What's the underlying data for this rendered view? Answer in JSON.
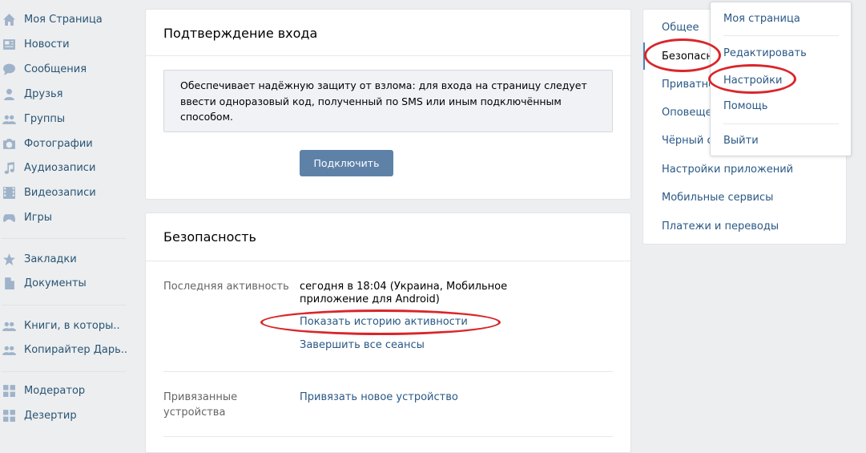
{
  "sidebar": {
    "items": [
      {
        "label": "Моя Страница",
        "icon": "home-icon"
      },
      {
        "label": "Новости",
        "icon": "news-icon"
      },
      {
        "label": "Сообщения",
        "icon": "messages-icon"
      },
      {
        "label": "Друзья",
        "icon": "friends-icon"
      },
      {
        "label": "Группы",
        "icon": "groups-icon"
      },
      {
        "label": "Фотографии",
        "icon": "camera-icon"
      },
      {
        "label": "Аудиозаписи",
        "icon": "music-note-icon"
      },
      {
        "label": "Видеозаписи",
        "icon": "film-icon"
      },
      {
        "label": "Игры",
        "icon": "gamepad-icon"
      },
      {
        "label": "Закладки",
        "icon": "star-icon"
      },
      {
        "label": "Документы",
        "icon": "document-icon"
      },
      {
        "label": "Книги, в которы..",
        "icon": "group-icon"
      },
      {
        "label": "Копирайтер Дарь..",
        "icon": "group-icon"
      },
      {
        "label": "Модератор",
        "icon": "apps-grid-icon"
      },
      {
        "label": "Дезертир",
        "icon": "apps-grid-icon"
      }
    ]
  },
  "login_confirm": {
    "title": "Подтверждение входа",
    "description": "Обеспечивает надёжную защиту от взлома: для входа на страницу следует ввести одноразовый код, полученный по SMS или иным подключённым способом.",
    "connect_button": "Подключить"
  },
  "security": {
    "title": "Безопасность",
    "last_activity_label": "Последняя активность",
    "last_activity_value": "сегодня в 18:04 (Украина, Мобильное приложение для Android)",
    "show_history_link": "Показать историю активности",
    "end_sessions_link": "Завершить все сеансы",
    "linked_devices_label": "Привязанные устройства",
    "link_device_link": "Привязать новое устройство"
  },
  "settings_menu": {
    "items": [
      {
        "label": "Общее"
      },
      {
        "label": "Безопасность"
      },
      {
        "label": "Приватность"
      },
      {
        "label": "Оповещения"
      },
      {
        "label": "Чёрный список"
      },
      {
        "label": "Настройки приложений"
      },
      {
        "label": "Мобильные сервисы"
      },
      {
        "label": "Платежи и переводы"
      }
    ]
  },
  "dropdown": {
    "items": [
      {
        "label": "Моя страница"
      },
      {
        "label": "Редактировать"
      },
      {
        "label": "Настройки"
      },
      {
        "label": "Помощь"
      },
      {
        "label": "Выйти"
      }
    ]
  },
  "colors": {
    "accent": "#5181b8",
    "link": "#2a5885",
    "annotation": "#d9262a"
  }
}
